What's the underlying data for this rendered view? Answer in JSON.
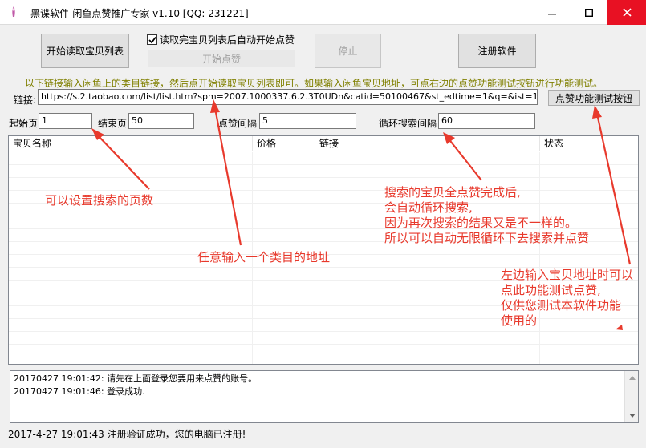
{
  "window": {
    "title": "黑谍软件-闲鱼点赞推广专家 v1.10  [QQ: 231221]"
  },
  "toolbar": {
    "start_read_label": "开始读取宝贝列表",
    "auto_like_checkbox_label": "读取完宝贝列表后自动开始点赞",
    "auto_like_checked": true,
    "start_like_label": "开始点赞",
    "stop_label": "停止",
    "register_label": "注册软件"
  },
  "hint_text": "以下链接输入闲鱼上的类目链接，然后点开始读取宝贝列表即可。如果输入闲鱼宝贝地址，可点右边的点赞功能测试按钮进行功能测试。",
  "link": {
    "label": "链接:",
    "value": "https://s.2.taobao.com/list/list.htm?spm=2007.1000337.6.2.3T0UDn&catid=50100467&st_edtime=1&q=&ist=1",
    "test_button_label": "点赞功能测试按钮"
  },
  "params": {
    "start_page_label": "起始页",
    "start_page_value": "1",
    "end_page_label": "结束页",
    "end_page_value": "50",
    "like_interval_label": "点赞间隔",
    "like_interval_value": "5",
    "loop_interval_label": "循环搜索间隔",
    "loop_interval_value": "60"
  },
  "table": {
    "columns": [
      "宝贝名称",
      "价格",
      "链接",
      "状态"
    ],
    "rows": []
  },
  "log": {
    "lines": [
      "20170427 19:01:42:  请先在上面登录您要用来点赞的账号。",
      "20170427 19:01:46:  登录成功."
    ]
  },
  "status": {
    "text": "2017-4-27 19:01:43  注册验证成功，您的电脑已注册!"
  },
  "annotations": {
    "pages_note": "可以设置搜索的页数",
    "category_note": "任意输入一个类目的地址",
    "loop_note": [
      "搜索的宝贝全点赞完成后,",
      "会自动循环搜索,",
      "因为再次搜索的结果又是不一样的。",
      "所以可以自动无限循环下去搜索并点赞"
    ],
    "test_note": [
      "左边输入宝贝地址时可以",
      "点此功能测试点赞,",
      "仅供您测试本软件功能",
      "使用的"
    ],
    "color": "#e8392c"
  }
}
